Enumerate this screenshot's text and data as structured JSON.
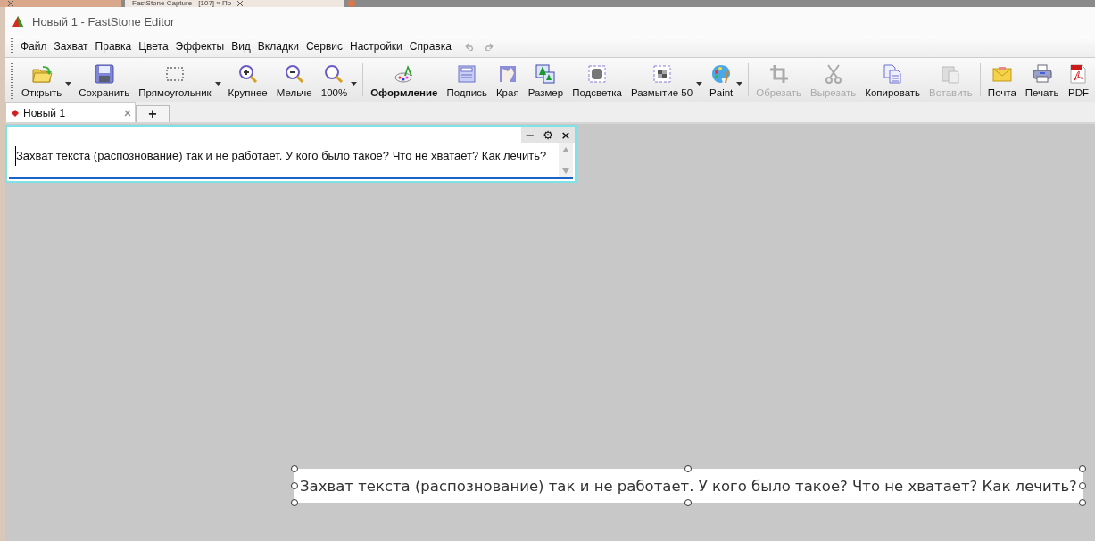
{
  "background_tabs": [
    {
      "selected": false
    },
    {
      "title": "FastStone Capture - [107] » По",
      "selected": true
    }
  ],
  "window": {
    "title": "Новый 1 - FastStone Editor"
  },
  "menu": [
    "Файл",
    "Захват",
    "Правка",
    "Цвета",
    "Эффекты",
    "Вид",
    "Вкладки",
    "Сервис",
    "Настройки",
    "Справка"
  ],
  "toolbar": {
    "groups": [
      [
        {
          "label": "Открыть",
          "dropdown": true,
          "disabled": false,
          "selected": false
        },
        {
          "label": "Сохранить",
          "dropdown": false,
          "disabled": false,
          "selected": false
        },
        {
          "label": "Прямоугольник",
          "dropdown": true,
          "disabled": false,
          "selected": false
        },
        {
          "label": "Крупнее",
          "dropdown": false,
          "disabled": false,
          "selected": false
        },
        {
          "label": "Мельче",
          "dropdown": false,
          "disabled": false,
          "selected": false
        },
        {
          "label": "100%",
          "dropdown": true,
          "disabled": false,
          "selected": false
        }
      ],
      [
        {
          "label": "Оформление",
          "dropdown": false,
          "disabled": false,
          "selected": true
        },
        {
          "label": "Подпись",
          "dropdown": false,
          "disabled": false,
          "selected": false
        },
        {
          "label": "Края",
          "dropdown": false,
          "disabled": false,
          "selected": false
        },
        {
          "label": "Размер",
          "dropdown": false,
          "disabled": false,
          "selected": false
        },
        {
          "label": "Подсветка",
          "dropdown": false,
          "disabled": false,
          "selected": false
        },
        {
          "label": "Размытие 50",
          "dropdown": true,
          "disabled": false,
          "selected": false
        },
        {
          "label": "Paint",
          "dropdown": true,
          "disabled": false,
          "selected": false
        }
      ],
      [
        {
          "label": "Обрезать",
          "dropdown": false,
          "disabled": true,
          "selected": false
        },
        {
          "label": "Вырезать",
          "dropdown": false,
          "disabled": true,
          "selected": false
        },
        {
          "label": "Копировать",
          "dropdown": false,
          "disabled": false,
          "selected": false
        },
        {
          "label": "Вставить",
          "dropdown": false,
          "disabled": true,
          "selected": false
        }
      ],
      [
        {
          "label": "Почта",
          "dropdown": false,
          "disabled": false,
          "selected": false
        },
        {
          "label": "Печать",
          "dropdown": false,
          "disabled": false,
          "selected": false
        },
        {
          "label": "PDF",
          "dropdown": false,
          "disabled": false,
          "selected": false
        }
      ]
    ]
  },
  "doc_tabs": [
    {
      "label": "Новый 1",
      "selected": true
    }
  ],
  "new_tab": "+",
  "ocr_panel": {
    "controls": [
      "−",
      "⚙",
      "×"
    ],
    "text": "Захват текста (распознование) так и не работает. У кого было такое? Что не хватает? Как лечить?"
  },
  "canvas_text": {
    "text": "Захват текста (распознование) так и не работает. У кого было такое? Что не хватает? Как лечить?",
    "selected": true
  }
}
